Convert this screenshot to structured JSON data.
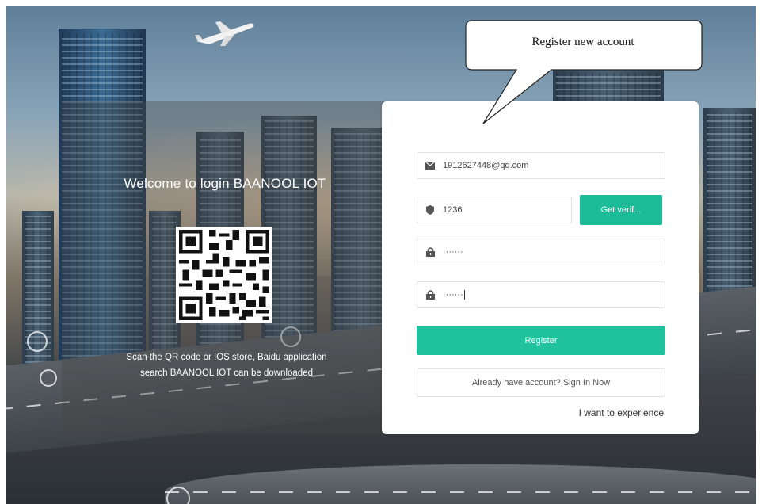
{
  "left_panel": {
    "welcome": "Welcome to login BAANOOL IOT",
    "scan_line1": "Scan the QR code or IOS store, Baidu application",
    "scan_line2": "search BAANOOL IOT can be downloaded"
  },
  "form": {
    "email_value": "1912627448@qq.com",
    "code_value": "1236",
    "get_code_label": "Get verif...",
    "password_value": "·······",
    "confirm_value": "·······",
    "register_label": "Register",
    "signin_label": "Already have account? Sign In Now",
    "experience_label": "I want to experience"
  },
  "callout": {
    "text": "Register new account"
  },
  "icons": {
    "email": "mail-icon",
    "code": "shield-icon",
    "password": "lock-icon",
    "confirm": "lock-icon"
  },
  "colors": {
    "accent": "#20c29d",
    "accent_dark": "#1dbc99"
  }
}
